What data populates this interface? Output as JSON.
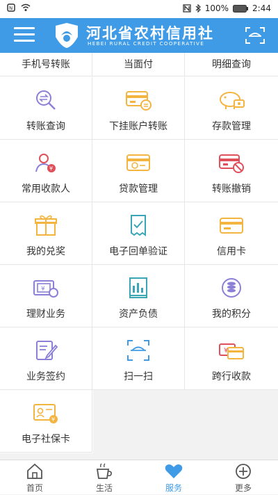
{
  "status_bar": {
    "battery": "100%",
    "time": "2:44"
  },
  "header": {
    "title_cn": "河北省农村信用社",
    "title_en": "HEBEI RURAL CREDIT COOPERATIVE"
  },
  "top_row": [
    "手机号转账",
    "当面付",
    "明细查询"
  ],
  "services": [
    {
      "label": "转账查询",
      "icon": "search-transfer-icon"
    },
    {
      "label": "下挂账户转账",
      "icon": "linked-account-transfer-icon"
    },
    {
      "label": "存款管理",
      "icon": "piggy-bank-icon"
    },
    {
      "label": "常用收款人",
      "icon": "payee-icon"
    },
    {
      "label": "贷款管理",
      "icon": "loan-card-icon"
    },
    {
      "label": "转账撤销",
      "icon": "transfer-cancel-icon"
    },
    {
      "label": "我的兑奖",
      "icon": "gift-icon"
    },
    {
      "label": "电子回单验证",
      "icon": "receipt-verify-icon"
    },
    {
      "label": "信用卡",
      "icon": "credit-card-icon"
    },
    {
      "label": "理财业务",
      "icon": "wealth-icon"
    },
    {
      "label": "资产负债",
      "icon": "assets-icon"
    },
    {
      "label": "我的积分",
      "icon": "points-icon"
    },
    {
      "label": "业务签约",
      "icon": "sign-contract-icon"
    },
    {
      "label": "扫一扫",
      "icon": "scan-icon"
    },
    {
      "label": "跨行收款",
      "icon": "interbank-collect-icon"
    },
    {
      "label": "电子社保卡",
      "icon": "social-security-card-icon"
    }
  ],
  "tabbar": [
    {
      "label": "首页",
      "icon": "home-icon"
    },
    {
      "label": "生活",
      "icon": "coffee-icon"
    },
    {
      "label": "服务",
      "icon": "heart-icon",
      "active": true
    },
    {
      "label": "更多",
      "icon": "plus-icon"
    }
  ],
  "colors": {
    "primary": "#3f9be6",
    "purple": "#8b7fd8",
    "orange": "#f3b440",
    "red": "#e0505a",
    "teal": "#3aa5b5"
  }
}
